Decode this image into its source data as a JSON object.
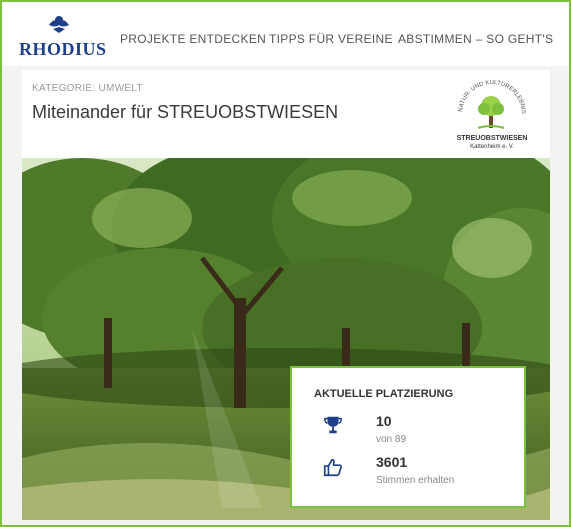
{
  "header": {
    "logo_text": "RHODIUS",
    "nav": [
      {
        "label": "PROJEKTE ENTDECKEN"
      },
      {
        "label": "TIPPS FÜR VEREINE"
      },
      {
        "label": "ABSTIMMEN – SO GEHT'S"
      }
    ]
  },
  "project": {
    "category": "KATEGORIE: UMWELT",
    "title": "Miteinander für STREUOBSTWIESEN",
    "partner_logo": {
      "arc_text": "NATUR- UND KULTURERLEBNIS",
      "name": "STREUOBSTWIESEN",
      "subtitle": "Kattenheim e. V."
    }
  },
  "ranking": {
    "title": "AKTUELLE PLATZIERUNG",
    "place": "10",
    "place_sub": "von 89",
    "votes": "3601",
    "votes_sub": "Stimmen erhalten"
  },
  "colors": {
    "accent_green": "#7dbf3f",
    "brand_blue": "#1f3f86",
    "icon_blue": "#1f3f86"
  },
  "icons": [
    "trophy-icon",
    "thumbs-up-icon"
  ]
}
